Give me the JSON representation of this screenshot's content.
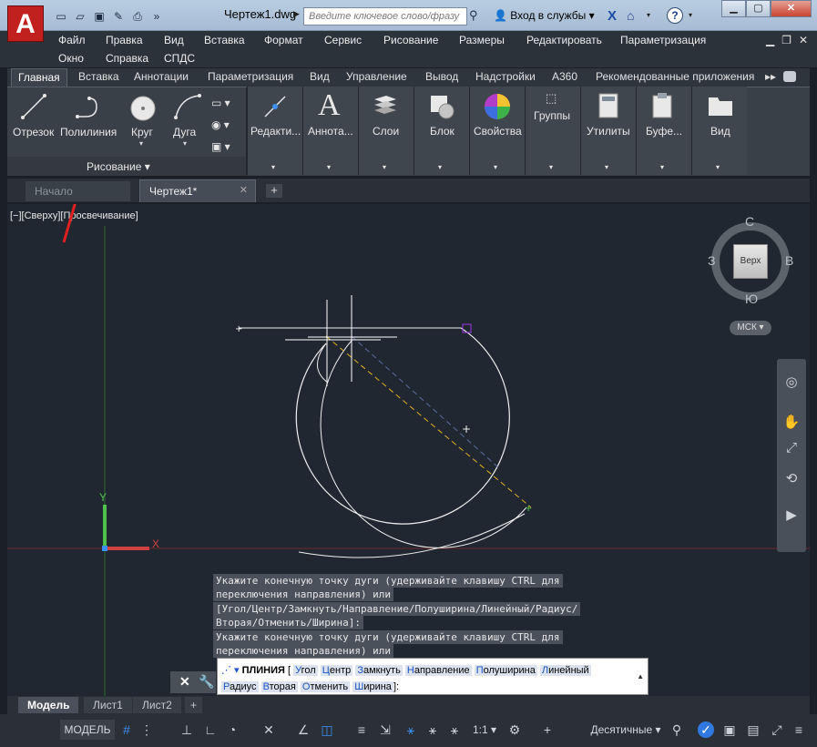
{
  "app": {
    "logo_letter": "A",
    "doc_title": "Чертеж1.dwg"
  },
  "titlebar": {
    "search_placeholder": "Введите ключевое слово/фразу",
    "login_label": "Вход в службы",
    "help_label": "?"
  },
  "menubar": {
    "row1": [
      "Файл",
      "Правка",
      "Вид",
      "Вставка",
      "Формат",
      "Сервис",
      "Рисование",
      "Размеры",
      "Редактировать",
      "Параметризация"
    ],
    "row2": [
      "Окно",
      "Справка",
      "СПДС"
    ]
  },
  "ribbon_tabs": [
    "Главная",
    "Вставка",
    "Аннотации",
    "Параметризация",
    "Вид",
    "Управление",
    "Вывод",
    "Надстройки",
    "A360",
    "Рекомендованные приложения"
  ],
  "ribbon": {
    "draw": {
      "line": "Отрезок",
      "polyline": "Полилиния",
      "circle": "Круг",
      "arc": "Дуга",
      "panel_title": "Рисование"
    },
    "panels": [
      "Редакти...",
      "Аннота...",
      "Слои",
      "Блок",
      "Свойства",
      "Группы",
      "Утилиты",
      "Буфе...",
      "Вид"
    ]
  },
  "file_tabs": {
    "start": "Начало",
    "drawing": "Чертеж1*",
    "close": "✕",
    "add": "+"
  },
  "viewport": {
    "label": "[−][Сверху][Просвечивание]"
  },
  "viewcube": {
    "top": "Верх",
    "north": "С",
    "south": "Ю",
    "west": "З",
    "east": "В",
    "wcs": "МСК"
  },
  "command_history": [
    "Укажите конечную точку дуги (удерживайте клавишу CTRL для",
    "переключения направления) или",
    "[Угол/Центр/Замкнуть/Направление/Полуширина/Линейный/Радиус/",
    "Вторая/Отменить/Ширина]:",
    "Укажите конечную точку дуги (удерживайте клавишу CTRL для",
    "переключения направления) или"
  ],
  "command_line": {
    "prefix": "ПЛИНИЯ",
    "bracket_open": "[",
    "bracket_close": "]:",
    "options": [
      {
        "key": "У",
        "rest": "гол"
      },
      {
        "key": "Ц",
        "rest": "ентр"
      },
      {
        "key": "З",
        "rest": "амкнуть"
      },
      {
        "key": "Н",
        "rest": "аправление"
      },
      {
        "key": "П",
        "rest": "олуширина"
      },
      {
        "key": "Л",
        "rest": "инейный"
      },
      {
        "key": "Р",
        "rest": "адиус"
      },
      {
        "key": "В",
        "rest": "торая"
      },
      {
        "key": "О",
        "rest": "тменить"
      },
      {
        "key": "Ш",
        "rest": "ирина"
      }
    ]
  },
  "layout_tabs": [
    "Модель",
    "Лист1",
    "Лист2"
  ],
  "statusbar": {
    "model": "МОДЕЛЬ",
    "scale": "1:1",
    "units": "Десятичные"
  },
  "colors": {
    "accent": "#3c8ef0",
    "canvas": "#212730",
    "annotation_arrow": "#e02020"
  }
}
